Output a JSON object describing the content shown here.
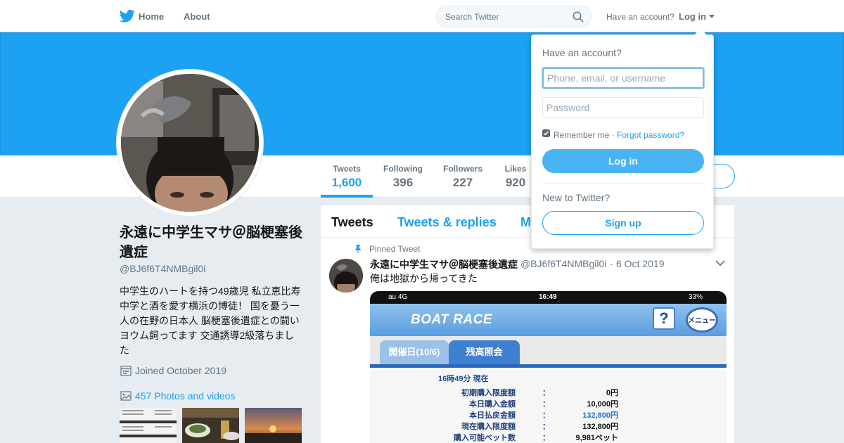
{
  "nav": {
    "home": "Home",
    "about": "About",
    "search_placeholder": "Search Twitter",
    "have_account": "Have an account?",
    "login": "Log in"
  },
  "profile": {
    "name": "永遠に中学生マサ＠脳梗塞後遺症",
    "handle": "@BJ6f6T4NMBgil0i",
    "bio": "中学生のハートを持つ49歳児 私立恵比寿中学と酒を愛す横浜の博徒！ 国を憂う一人の在野の日本人 脳梗塞後遺症との闘いヨウム飼ってます 交通誘導2級落ちました",
    "joined": "Joined October 2019",
    "photos": "457 Photos and videos"
  },
  "stats": [
    {
      "label": "Tweets",
      "value": "1,600"
    },
    {
      "label": "Following",
      "value": "396"
    },
    {
      "label": "Followers",
      "value": "227"
    },
    {
      "label": "Likes",
      "value": "920"
    }
  ],
  "timeline": {
    "tabs": [
      "Tweets",
      "Tweets & replies",
      "M"
    ],
    "pinned_label": "Pinned Tweet",
    "tweet": {
      "name": "永遠に中学生マサ＠脳梗塞後遺症",
      "handle": "@BJ6f6T4NMBgil0i",
      "dot": "·",
      "date": "6 Oct 2019",
      "text": "俺は地獄から帰ってきた"
    }
  },
  "media": {
    "carrier": "au  4G",
    "time": "16:49",
    "battery": "33%",
    "title": "BOAT RACE",
    "help": "?",
    "menu": "メニュー",
    "tab1": "開催日(10/6)",
    "tab2": "残高照会",
    "now": "16時49分  現在",
    "rows": [
      {
        "label": "初期購入限度額",
        "colon": "：",
        "value": "0円"
      },
      {
        "label": "本日購入金額",
        "colon": "：",
        "value": "10,000円"
      },
      {
        "label": "本日払戻金額",
        "colon": "：",
        "value": "132,800円"
      },
      {
        "label": "現在購入限度額",
        "colon": "：",
        "value": "132,800円"
      },
      {
        "label": "購入可能ベット数",
        "colon": "：",
        "value": "9,981ベット"
      }
    ]
  },
  "login_dropdown": {
    "title": "Have an account?",
    "username_placeholder": "Phone, email, or username",
    "password_placeholder": "Password",
    "remember": "Remember me",
    "separator": "·",
    "forgot": "Forgot password?",
    "login_button": "Log in",
    "new_to": "New to Twitter?",
    "signup_button": "Sign up"
  },
  "colors": {
    "accent": "#1da1f2",
    "banner": "#1da1f2",
    "background": "#e6ecf0"
  }
}
